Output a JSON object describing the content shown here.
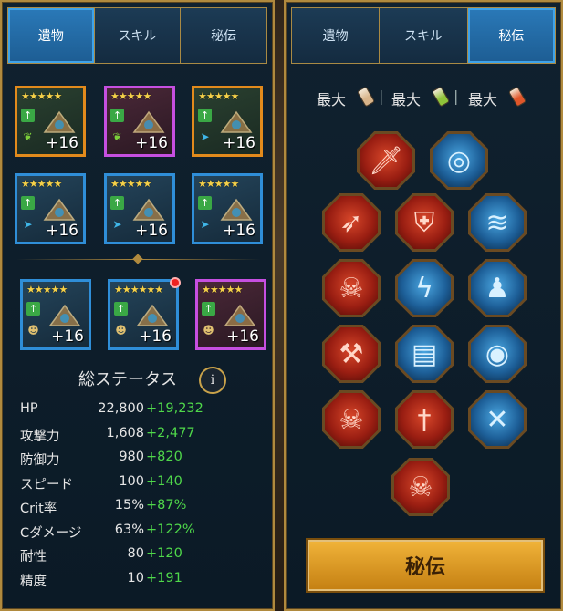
{
  "left_panel": {
    "tabs": [
      {
        "label": "遺物",
        "active": true
      },
      {
        "label": "スキル",
        "active": false
      },
      {
        "label": "秘伝",
        "active": false
      }
    ],
    "gear": [
      {
        "stars": "★★★★★",
        "level": "+16",
        "rarity": "legendary",
        "set_icon": "leaf-icon",
        "notify": false
      },
      {
        "stars": "★★★★★",
        "level": "+16",
        "rarity": "epic",
        "set_icon": "leaf-icon",
        "notify": false
      },
      {
        "stars": "★★★★★",
        "level": "+16",
        "rarity": "legendary",
        "set_icon": "speed-icon",
        "notify": false
      },
      {
        "stars": "★★★★★",
        "level": "+16",
        "rarity": "rare",
        "set_icon": "speed-icon",
        "notify": false
      },
      {
        "stars": "★★★★★",
        "level": "+16",
        "rarity": "rare",
        "set_icon": "speed-icon",
        "notify": false
      },
      {
        "stars": "★★★★★",
        "level": "+16",
        "rarity": "rare",
        "set_icon": "speed-icon",
        "notify": false
      },
      {
        "stars": "★★★★★",
        "level": "+16",
        "rarity": "rare",
        "set_icon": "face-icon",
        "notify": false
      },
      {
        "stars": "★★★★★★",
        "level": "+16",
        "rarity": "rare",
        "set_icon": "face-icon",
        "notify": true
      },
      {
        "stars": "★★★★★",
        "level": "+16",
        "rarity": "epic",
        "set_icon": "face-icon",
        "notify": false
      }
    ],
    "stats_title": "総ステータス",
    "info_label": "i",
    "stats": [
      {
        "label": "HP",
        "value": "22,800",
        "bonus": "+19,232"
      },
      {
        "label": "攻撃力",
        "value": "1,608",
        "bonus": "+2,477"
      },
      {
        "label": "防御力",
        "value": "980",
        "bonus": "+820"
      },
      {
        "label": "スピード",
        "value": "100",
        "bonus": "+140"
      },
      {
        "label": "Crit率",
        "value": "15%",
        "bonus": "+87%"
      },
      {
        "label": "Cダメージ",
        "value": "63%",
        "bonus": "+122%"
      },
      {
        "label": "耐性",
        "value": "80",
        "bonus": "+120"
      },
      {
        "label": "精度",
        "value": "10",
        "bonus": "+191"
      }
    ]
  },
  "right_panel": {
    "tabs": [
      {
        "label": "遺物",
        "active": false
      },
      {
        "label": "スキル",
        "active": false
      },
      {
        "label": "秘伝",
        "active": true
      }
    ],
    "max_labels": [
      "最大",
      "最大",
      "最大"
    ],
    "separator": "|",
    "potion_colors": [
      "#d8b48a",
      "#8fc43a",
      "#e0562a"
    ],
    "masteries": [
      {
        "icon": "dagger-slash-icon",
        "color": "red",
        "glyph": "🗡"
      },
      {
        "icon": "target-burst-icon",
        "color": "blue",
        "glyph": "◎"
      },
      {
        "icon": "arrow-volley-icon",
        "color": "red",
        "glyph": "➶"
      },
      {
        "icon": "shield-strike-icon",
        "color": "red",
        "glyph": "⛨"
      },
      {
        "icon": "wind-slash-icon",
        "color": "blue",
        "glyph": "≋"
      },
      {
        "icon": "skull-slash-icon",
        "color": "red",
        "glyph": "☠"
      },
      {
        "icon": "crack-icon",
        "color": "blue",
        "glyph": "ϟ"
      },
      {
        "icon": "silhouette-icon",
        "color": "blue",
        "glyph": "♟"
      },
      {
        "icon": "axe-icon",
        "color": "red",
        "glyph": "⚒"
      },
      {
        "icon": "book-icon",
        "color": "blue",
        "glyph": "▤"
      },
      {
        "icon": "eyes-icon",
        "color": "blue",
        "glyph": "◉"
      },
      {
        "icon": "twin-skulls-icon",
        "color": "red",
        "glyph": "☠"
      },
      {
        "icon": "sword-icon",
        "color": "red",
        "glyph": "†"
      },
      {
        "icon": "crossbones-icon",
        "color": "blue",
        "glyph": "✕"
      },
      {
        "icon": "spartan-skull-icon",
        "color": "red",
        "glyph": "☠"
      }
    ],
    "button_label": "秘伝"
  }
}
